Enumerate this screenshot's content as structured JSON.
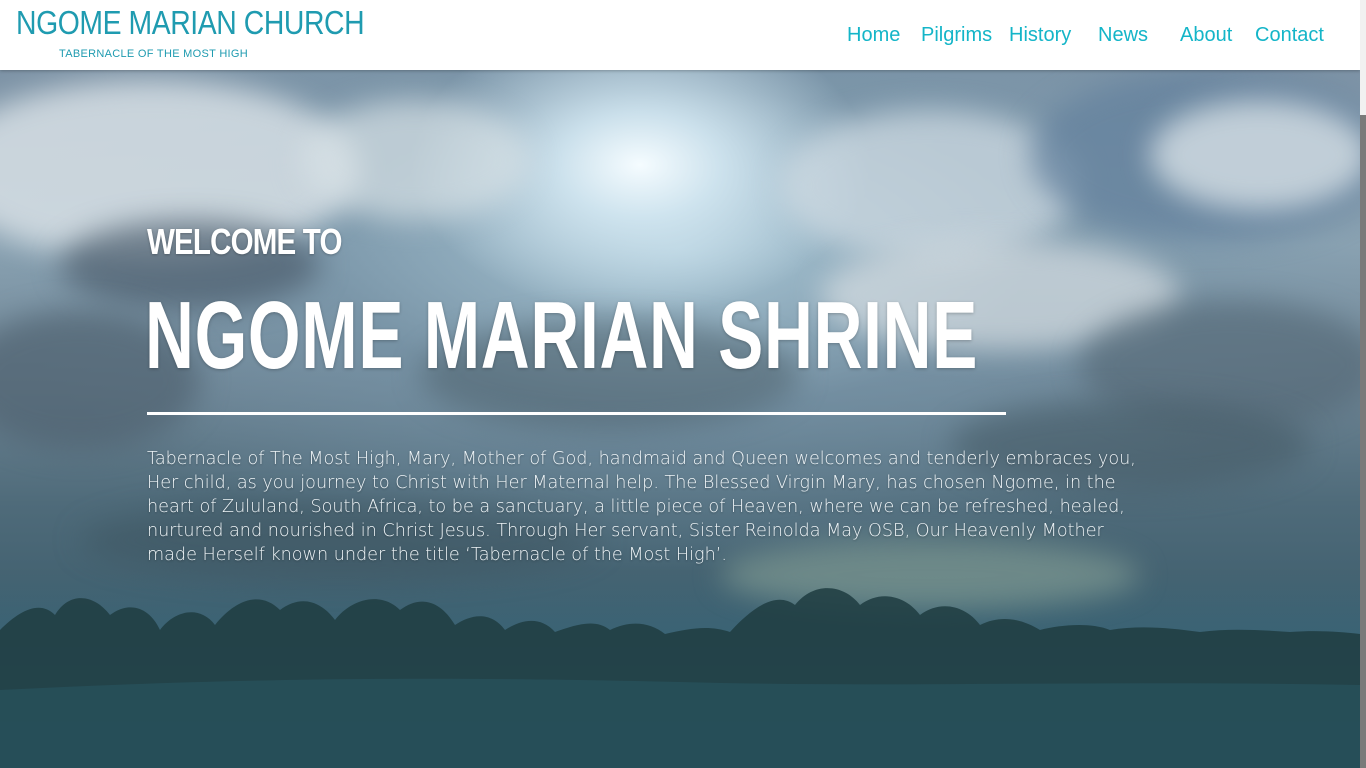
{
  "header": {
    "logo_title": "NGOME MARIAN CHURCH",
    "logo_subtitle": "TABERNACLE OF THE MOST HIGH"
  },
  "nav": {
    "items": [
      {
        "label": "Home"
      },
      {
        "label": "Pilgrims"
      },
      {
        "label": "History"
      },
      {
        "label": "News"
      },
      {
        "label": "About"
      },
      {
        "label": "Contact"
      }
    ]
  },
  "hero": {
    "welcome": "WELCOME TO",
    "title": "NGOME MARIAN SHRINE",
    "intro": "Tabernacle of The Most High, Mary, Mother of God, handmaid and Queen welcomes and tenderly embraces you, Her child, as you journey to Christ with Her Maternal help. The Blessed Virgin Mary, has chosen Ngome, in the heart of Zululand, South Africa, to be a sanctuary, a little piece of Heaven, where we can be refreshed, healed, nurtured and nourished in Christ Jesus. Through Her servant, Sister Reinolda May OSB, Our Heavenly Mother made Herself known under the title ‘Tabernacle of the Most High’."
  },
  "colors": {
    "brand": "#1f9bb0",
    "nav_link": "#14b5c8",
    "header_bg": "#ffffff",
    "hero_text": "#ffffff"
  }
}
